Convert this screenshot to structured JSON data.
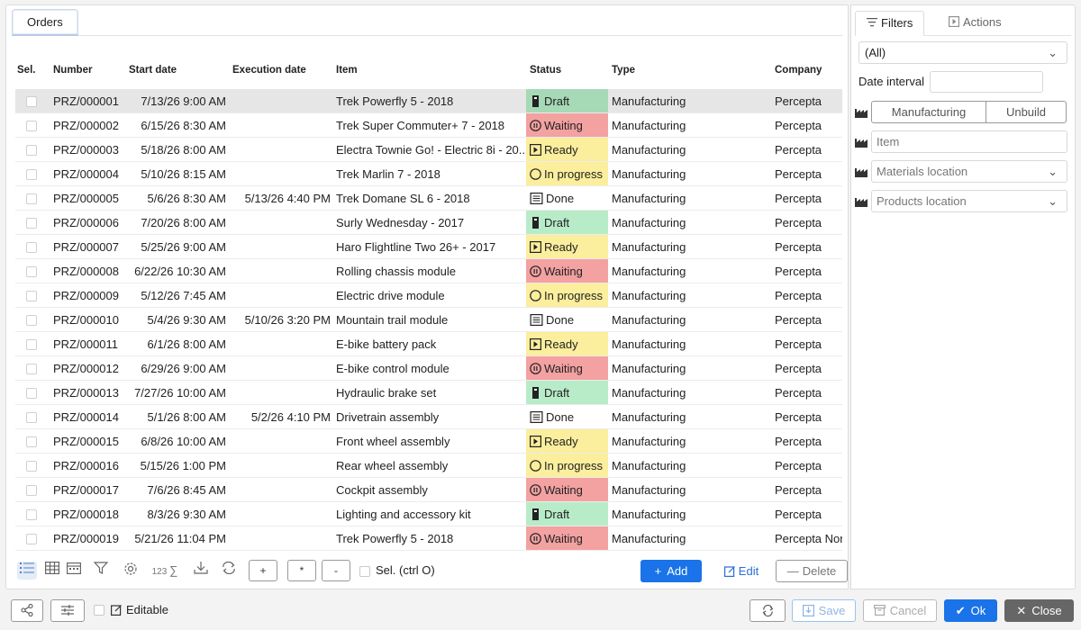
{
  "main_tab": "Orders",
  "columns": {
    "sel": "Sel.",
    "number": "Number",
    "start_date": "Start date",
    "execution_date": "Execution date",
    "item": "Item",
    "status": "Status",
    "type": "Type",
    "company": "Company"
  },
  "rows": [
    {
      "number": "PRZ/000001",
      "start": "7/13/26 9:00 AM",
      "exec": "",
      "item": "Trek Powerfly 5 - 2018",
      "status": "Draft",
      "type": "Manufacturing",
      "company": "Percepta"
    },
    {
      "number": "PRZ/000002",
      "start": "6/15/26 8:30 AM",
      "exec": "",
      "item": "Trek Super Commuter+ 7 - 2018",
      "status": "Waiting",
      "type": "Manufacturing",
      "company": "Percepta"
    },
    {
      "number": "PRZ/000003",
      "start": "5/18/26 8:00 AM",
      "exec": "",
      "item": "Electra Townie Go! - Electric 8i - 20...",
      "status": "Ready",
      "type": "Manufacturing",
      "company": "Percepta"
    },
    {
      "number": "PRZ/000004",
      "start": "5/10/26 8:15 AM",
      "exec": "",
      "item": "Trek Marlin 7 - 2018",
      "status": "In progress",
      "type": "Manufacturing",
      "company": "Percepta"
    },
    {
      "number": "PRZ/000005",
      "start": "5/6/26 8:30 AM",
      "exec": "5/13/26 4:40 PM",
      "item": "Trek Domane SL 6 - 2018",
      "status": "Done",
      "type": "Manufacturing",
      "company": "Percepta"
    },
    {
      "number": "PRZ/000006",
      "start": "7/20/26 8:00 AM",
      "exec": "",
      "item": "Surly Wednesday - 2017",
      "status": "Draft",
      "type": "Manufacturing",
      "company": "Percepta"
    },
    {
      "number": "PRZ/000007",
      "start": "5/25/26 9:00 AM",
      "exec": "",
      "item": "Haro Flightline Two 26+ - 2017",
      "status": "Ready",
      "type": "Manufacturing",
      "company": "Percepta"
    },
    {
      "number": "PRZ/000008",
      "start": "6/22/26 10:30 AM",
      "exec": "",
      "item": "Rolling chassis module",
      "status": "Waiting",
      "type": "Manufacturing",
      "company": "Percepta"
    },
    {
      "number": "PRZ/000009",
      "start": "5/12/26 7:45 AM",
      "exec": "",
      "item": "Electric drive module",
      "status": "In progress",
      "type": "Manufacturing",
      "company": "Percepta"
    },
    {
      "number": "PRZ/000010",
      "start": "5/4/26 9:30 AM",
      "exec": "5/10/26 3:20 PM",
      "item": "Mountain trail module",
      "status": "Done",
      "type": "Manufacturing",
      "company": "Percepta"
    },
    {
      "number": "PRZ/000011",
      "start": "6/1/26 8:00 AM",
      "exec": "",
      "item": "E-bike battery pack",
      "status": "Ready",
      "type": "Manufacturing",
      "company": "Percepta"
    },
    {
      "number": "PRZ/000012",
      "start": "6/29/26 9:00 AM",
      "exec": "",
      "item": "E-bike control module",
      "status": "Waiting",
      "type": "Manufacturing",
      "company": "Percepta"
    },
    {
      "number": "PRZ/000013",
      "start": "7/27/26 10:00 AM",
      "exec": "",
      "item": "Hydraulic brake set",
      "status": "Draft",
      "type": "Manufacturing",
      "company": "Percepta"
    },
    {
      "number": "PRZ/000014",
      "start": "5/1/26 8:00 AM",
      "exec": "5/2/26 4:10 PM",
      "item": "Drivetrain assembly",
      "status": "Done",
      "type": "Manufacturing",
      "company": "Percepta"
    },
    {
      "number": "PRZ/000015",
      "start": "6/8/26 10:00 AM",
      "exec": "",
      "item": "Front wheel assembly",
      "status": "Ready",
      "type": "Manufacturing",
      "company": "Percepta"
    },
    {
      "number": "PRZ/000016",
      "start": "5/15/26 1:00 PM",
      "exec": "",
      "item": "Rear wheel assembly",
      "status": "In progress",
      "type": "Manufacturing",
      "company": "Percepta"
    },
    {
      "number": "PRZ/000017",
      "start": "7/6/26 8:45 AM",
      "exec": "",
      "item": "Cockpit assembly",
      "status": "Waiting",
      "type": "Manufacturing",
      "company": "Percepta"
    },
    {
      "number": "PRZ/000018",
      "start": "8/3/26 9:30 AM",
      "exec": "",
      "item": "Lighting and accessory kit",
      "status": "Draft",
      "type": "Manufacturing",
      "company": "Percepta"
    },
    {
      "number": "PRZ/000019",
      "start": "5/21/26 11:04 PM",
      "exec": "",
      "item": "Trek Powerfly 5 - 2018",
      "status": "Waiting",
      "type": "Manufacturing",
      "company": "Percepta Nor"
    }
  ],
  "toolbar": {
    "sum_label": "123",
    "sum_symbol": "∑",
    "plus": "+",
    "star": "*",
    "minus": "-",
    "sel_label": "Sel. (ctrl O)",
    "add_label": "Add",
    "edit_label": "Edit",
    "delete_label": "Delete"
  },
  "side": {
    "tab_filters": "Filters",
    "tab_actions": "Actions",
    "all_select": "(All)",
    "date_interval": "Date interval",
    "seg_manufacturing": "Manufacturing",
    "seg_unbuild": "Unbuild",
    "item_placeholder": "Item",
    "materials_location": "Materials location",
    "products_location": "Products location"
  },
  "bottom": {
    "editable_label": "Editable",
    "save": "Save",
    "cancel": "Cancel",
    "ok": "Ok",
    "close": "Close"
  },
  "colors": {
    "draft": "#b8ecc8",
    "waiting": "#f4a1a1",
    "ready": "#fbee9c",
    "accent": "#1a73e8"
  }
}
